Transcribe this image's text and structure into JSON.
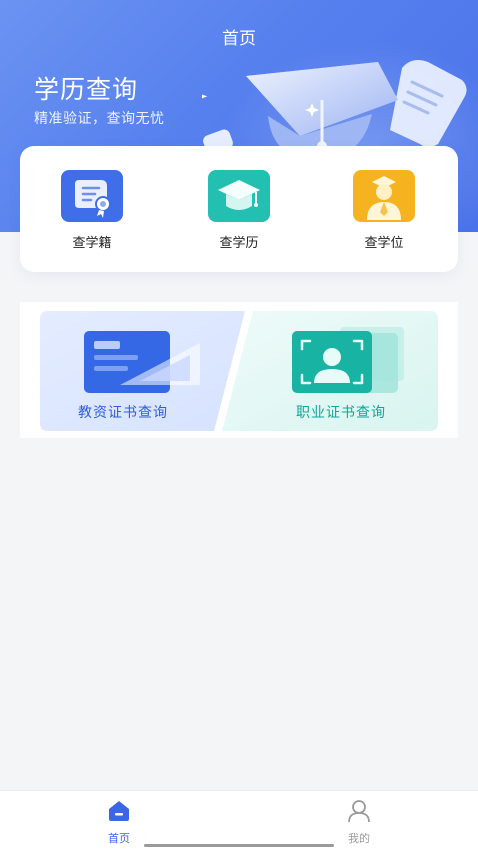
{
  "header": {
    "title": "首页",
    "hero_title": "学历查询",
    "hero_subtitle": "精准验证，查询无忧"
  },
  "quick_actions": [
    {
      "label": "查学籍",
      "icon": "certificate-scroll-icon",
      "color": "#3f6ee8"
    },
    {
      "label": "查学历",
      "icon": "graduation-cap-icon",
      "color": "#23bfb0"
    },
    {
      "label": "查学位",
      "icon": "graduate-person-icon",
      "color": "#f6b320"
    }
  ],
  "cert_queries": [
    {
      "label": "教资证书查询",
      "icon": "teacher-certificate-icon",
      "color": "#3468e5"
    },
    {
      "label": "职业证书查询",
      "icon": "vocational-certificate-icon",
      "color": "#19b3a4"
    }
  ],
  "tabbar": [
    {
      "label": "首页",
      "icon": "home-icon",
      "active": true
    },
    {
      "label": "我的",
      "icon": "user-icon",
      "active": false
    }
  ],
  "colors": {
    "primary": "#5680ee",
    "active_tab": "#3d66e6",
    "inactive_tab": "#9a9a9a"
  }
}
